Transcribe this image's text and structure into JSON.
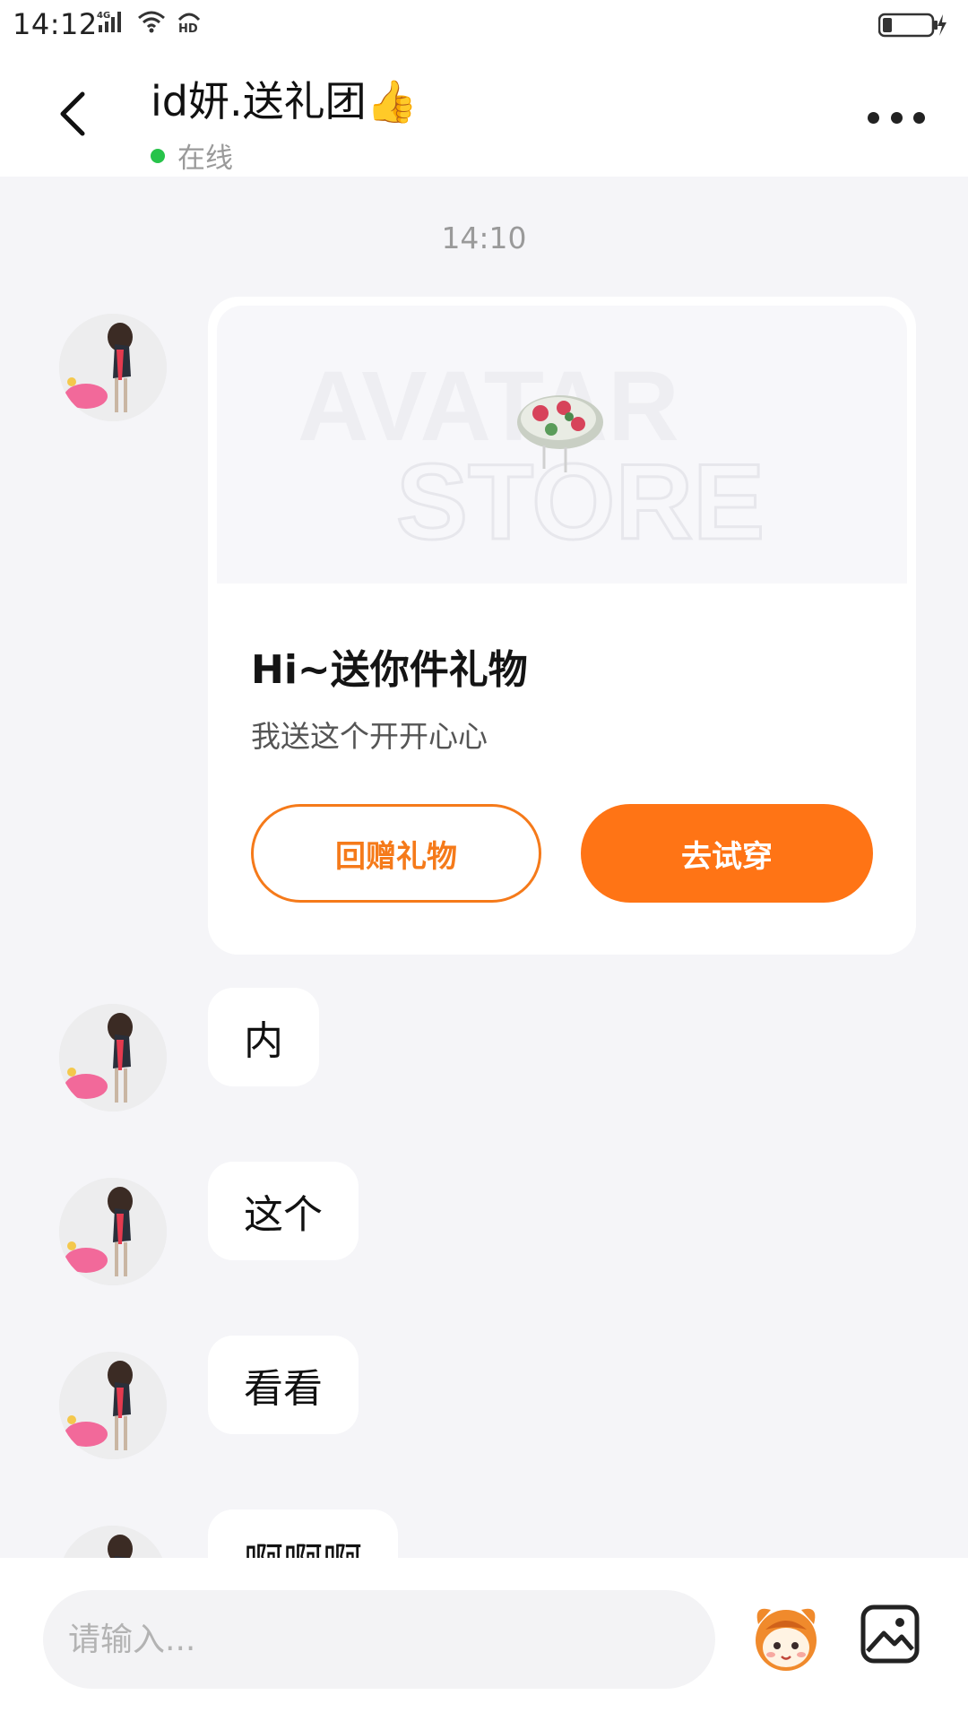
{
  "status_bar": {
    "time": "14:12",
    "network": "4G",
    "hd": "HD"
  },
  "header": {
    "title": "id妍.送礼团👍",
    "status": "在线"
  },
  "chat": {
    "timestamp": "14:10",
    "gift_card": {
      "banner_watermark_line1": "AVATAR",
      "banner_watermark_line2": "STORE",
      "title": "Hi~送你件礼物",
      "subtitle": "我送这个开开心心",
      "return_gift_label": "回赠礼物",
      "try_on_label": "去试穿"
    },
    "messages": [
      {
        "text": "内"
      },
      {
        "text": "这个"
      },
      {
        "text": "看看"
      },
      {
        "text": "啊啊啊"
      }
    ]
  },
  "input": {
    "placeholder": "请输入..."
  },
  "colors": {
    "accent": "#ff7415",
    "online": "#27c34a",
    "background": "#f5f5f8"
  },
  "icons": [
    "back-arrow-icon",
    "more-dots-icon",
    "emoji-mascot-icon",
    "image-icon"
  ]
}
